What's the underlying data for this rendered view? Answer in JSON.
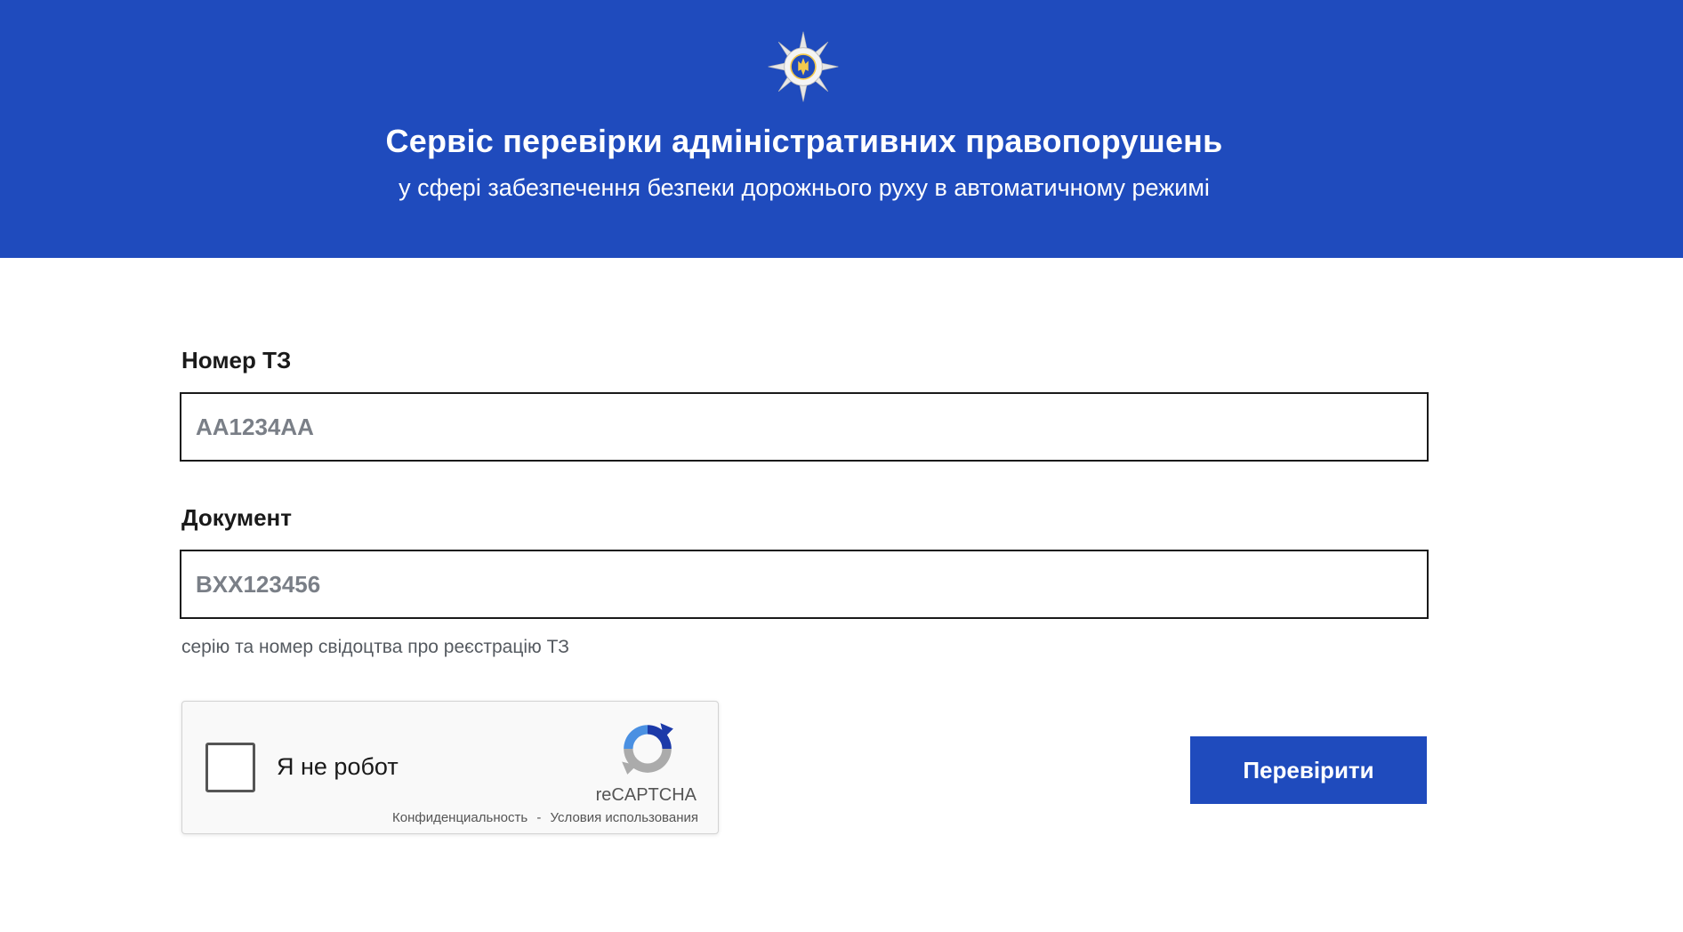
{
  "header": {
    "title": "Сервіс перевірки адміністративних правопорушень",
    "subtitle": "у сфері забезпечення безпеки дорожнього руху в автоматичному режимі",
    "emblem_icon": "police-emblem-icon"
  },
  "form": {
    "vehicle_number": {
      "label": "Номер ТЗ",
      "placeholder": "AA1234AA",
      "value": ""
    },
    "document": {
      "label": "Документ",
      "placeholder": "BXX123456",
      "value": "",
      "hint": "серію та номер свідоцтва про реєстрацію ТЗ"
    },
    "submit_label": "Перевірити"
  },
  "recaptcha": {
    "label": "Я не робот",
    "brand": "reCAPTCHA",
    "privacy_link": "Конфиденциальность",
    "separator": "-",
    "terms_link": "Условия использования",
    "logo_icon": "recaptcha-logo-icon"
  },
  "colors": {
    "brand_blue": "#1f4bbd",
    "input_border": "#1a1a1a",
    "placeholder": "#7a7f87",
    "emblem_gold": "#f2c94c"
  }
}
